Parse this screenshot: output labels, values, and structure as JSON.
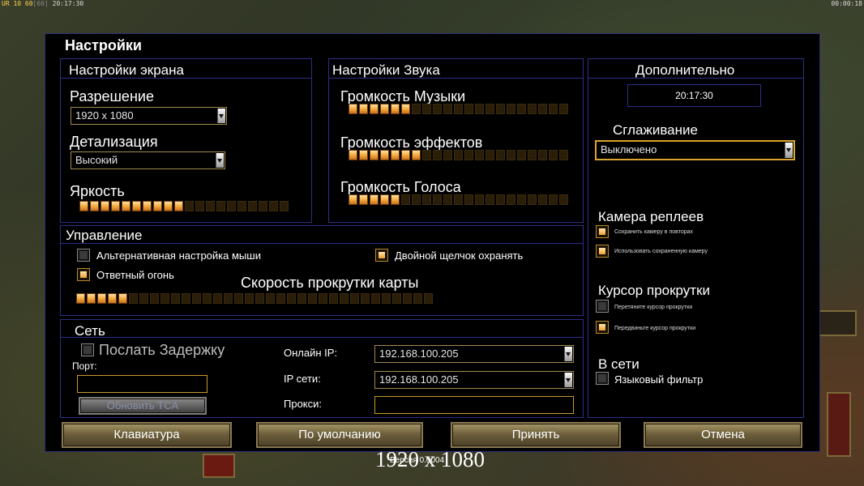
{
  "topbar": {
    "left_a": "UR 10 60",
    "left_b": "[60]",
    "left_c": "20:17:30",
    "right": "00:00:18"
  },
  "window": {
    "title": "Настройки"
  },
  "screen": {
    "title": "Настройки экрана",
    "resolution_label": "Разрешение",
    "resolution_value": "1920 x 1080",
    "detail_label": "Детализация",
    "detail_value": "Высокий",
    "brightness_label": "Яркость",
    "brightness_level": 10,
    "brightness_segments": 20
  },
  "sound": {
    "title": "Настройки Звука",
    "music_label": "Громкость Музыки",
    "music_level": 6,
    "effects_label": "Громкость эффектов",
    "effects_level": 7,
    "voice_label": "Громкость Голоса",
    "voice_level": 5,
    "segments": 21
  },
  "extra": {
    "title": "Дополнительно",
    "time": "20:17:30",
    "aa_label": "Сглаживание",
    "aa_value": "Выключено",
    "replay_title": "Камера реплеев",
    "replay_opt1": "Сохранить камеру в повторах",
    "replay_opt2": "Использовать сохраненную камеру",
    "cursor_title": "Курсор прокрутки",
    "cursor_opt1": "Перетяните курсор прокрутки",
    "cursor_opt2": "Передвиньте курсор прокрутки",
    "online_title": "В сети",
    "lang_filter": "Языковый фильтр"
  },
  "control": {
    "title": "Управление",
    "alt_mouse": "Альтернативная настройка мыши",
    "double_click": "Двойной щелчок охранять",
    "return_fire": "Ответный огонь",
    "scroll_label": "Скорость прокрутки карты",
    "scroll_level": 5,
    "segments": 34
  },
  "network": {
    "title": "Сеть",
    "send_delay": "Послать Задержку",
    "port_label": "Порт:",
    "port_value": "",
    "update_tca": "Обновить TCA",
    "online_ip_label": "Онлайн IP:",
    "online_ip_value": "192.168.100.205",
    "lan_ip_label": "IP сети:",
    "lan_ip_value": "192.168.100.205",
    "proxy_label": "Прокси:",
    "proxy_value": ""
  },
  "buttons": {
    "keyboard": "Клавиатура",
    "defaults": "По умолчанию",
    "accept": "Принять",
    "cancel": "Отмена"
  },
  "overlay": {
    "resolution": "1920 x 1080",
    "version": "Версия 0.0004"
  }
}
